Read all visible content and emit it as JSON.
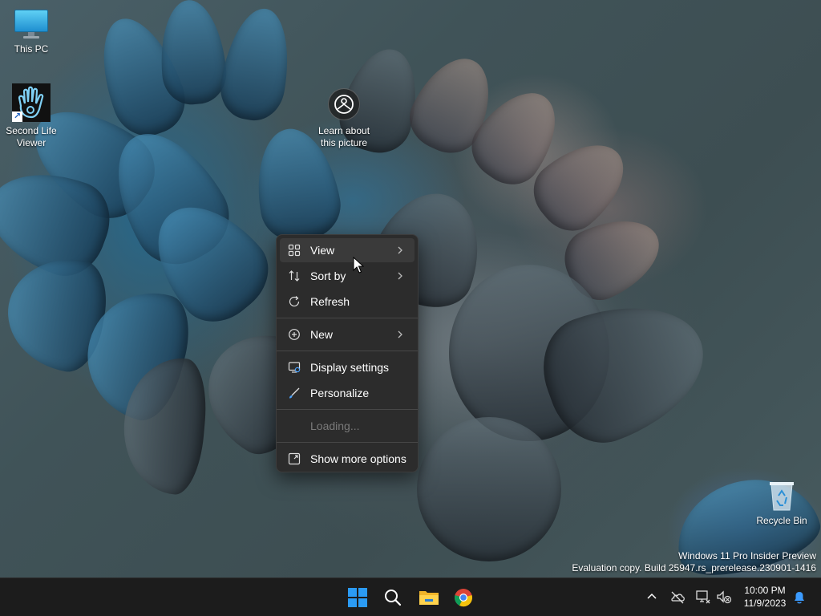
{
  "desktop": {
    "icons": [
      {
        "label": "This PC"
      },
      {
        "label": "Second Life Viewer"
      },
      {
        "label": "Learn about this picture"
      },
      {
        "label": "Recycle Bin"
      }
    ],
    "watermark": {
      "line1": "Windows 11 Pro Insider Preview",
      "line2": "Evaluation copy. Build 25947.rs_prerelease.230901-1416"
    }
  },
  "context_menu": {
    "items": [
      {
        "label": "View",
        "icon": "grid-icon",
        "submenu": true
      },
      {
        "label": "Sort by",
        "icon": "sort-icon",
        "submenu": true
      },
      {
        "label": "Refresh",
        "icon": "refresh-icon"
      },
      {
        "label": "New",
        "icon": "plus-circle-icon",
        "submenu": true
      },
      {
        "label": "Display settings",
        "icon": "display-icon"
      },
      {
        "label": "Personalize",
        "icon": "brush-icon"
      },
      {
        "label": "Loading...",
        "disabled": true
      },
      {
        "label": "Show more options",
        "icon": "expand-icon"
      }
    ]
  },
  "taskbar": {
    "apps": [
      "start-icon",
      "search-icon",
      "file-explorer-icon",
      "chrome-icon"
    ],
    "clock": {
      "time": "10:00 PM",
      "date": "11/9/2023"
    }
  },
  "colors": {
    "taskbar_bg": "#1c1c1c",
    "menu_bg": "#2c2c2c",
    "menu_hover": "#3a3a3a",
    "accent_blue": "#1e90ff",
    "start_blue": "#2b9bf4"
  }
}
